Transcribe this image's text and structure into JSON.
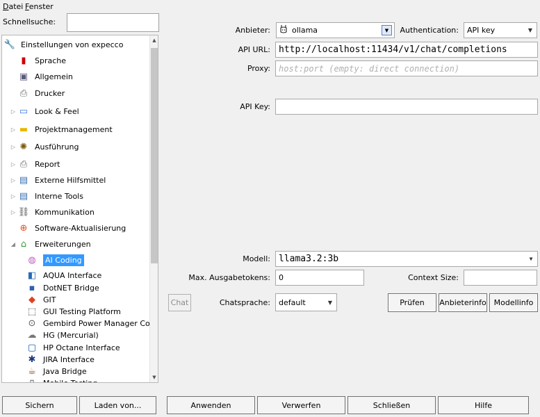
{
  "menu": {
    "datei_first": "D",
    "datei_rest": "atei",
    "fenster_first": "F",
    "fenster_rest": "enster"
  },
  "quicksearch": {
    "label": "Schnellsuche:",
    "value": ""
  },
  "tree": {
    "items": [
      {
        "label": "Einstellungen von expecco",
        "icon": "tools-icon",
        "level": 0,
        "expander": "none"
      },
      {
        "label": "Sprache",
        "icon": "flag-icon",
        "level": 1,
        "expander": "none"
      },
      {
        "label": "Allgemein",
        "icon": "general-icon",
        "level": 1,
        "expander": "none"
      },
      {
        "label": "Drucker",
        "icon": "printer-icon",
        "level": 1,
        "expander": "none"
      },
      {
        "label": "Look & Feel",
        "icon": "monitor-icon",
        "level": 1,
        "expander": "collapsed"
      },
      {
        "label": "Projektmanagement",
        "icon": "folder-icon",
        "level": 1,
        "expander": "collapsed"
      },
      {
        "label": "Ausführung",
        "icon": "gear-icon",
        "level": 1,
        "expander": "collapsed"
      },
      {
        "label": "Report",
        "icon": "printer-icon",
        "level": 1,
        "expander": "collapsed"
      },
      {
        "label": "Externe Hilfsmittel",
        "icon": "window-icon",
        "level": 1,
        "expander": "collapsed"
      },
      {
        "label": "Interne Tools",
        "icon": "window-icon",
        "level": 1,
        "expander": "collapsed"
      },
      {
        "label": "Kommunikation",
        "icon": "network-icon",
        "level": 1,
        "expander": "collapsed"
      },
      {
        "label": "Software-Aktualisierung",
        "icon": "update-icon",
        "level": 1,
        "expander": "none"
      },
      {
        "label": "Erweiterungen",
        "icon": "plugin-icon",
        "level": 1,
        "expander": "expanded"
      },
      {
        "label": "AI Coding",
        "icon": "brain-icon",
        "level": 2,
        "expander": "none",
        "selected": true
      },
      {
        "label": "AQUA Interface",
        "icon": "aqua-icon",
        "level": 2,
        "expander": "none"
      },
      {
        "label": "DotNET Bridge",
        "icon": "dotnet-icon",
        "level": 2,
        "expander": "none"
      },
      {
        "label": "GIT",
        "icon": "git-icon",
        "level": 2,
        "expander": "none"
      },
      {
        "label": "GUI Testing Platform",
        "icon": "gui-testing-icon",
        "level": 2,
        "expander": "none"
      },
      {
        "label": "Gembird Power Manager Con",
        "icon": "power-manager-icon",
        "level": 2,
        "expander": "none"
      },
      {
        "label": "HG (Mercurial)",
        "icon": "mercurial-icon",
        "level": 2,
        "expander": "none"
      },
      {
        "label": "HP Octane Interface",
        "icon": "octane-icon",
        "level": 2,
        "expander": "none"
      },
      {
        "label": "JIRA Interface",
        "icon": "jira-icon",
        "level": 2,
        "expander": "none"
      },
      {
        "label": "Java Bridge",
        "icon": "java-icon",
        "level": 2,
        "expander": "none"
      },
      {
        "label": "Mobile Testing",
        "icon": "mobile-icon",
        "level": 2,
        "expander": "none"
      }
    ]
  },
  "form": {
    "provider_label": "Anbieter:",
    "provider_value": "ollama",
    "auth_label": "Authentication:",
    "auth_value": "API key",
    "apiurl_label": "API URL:",
    "apiurl_value": "http://localhost:11434/v1/chat/completions",
    "proxy_label": "Proxy:",
    "proxy_placeholder": "host:port  (empty: direct connection)",
    "apikey_label": "API Key:",
    "apikey_value": "",
    "model_label": "Modell:",
    "model_value": "llama3.2:3b",
    "maxtokens_label": "Max. Ausgabetokens:",
    "maxtokens_value": "0",
    "context_label": "Context Size:",
    "context_value": "",
    "chat_button": "Chat",
    "chatlang_label": "Chatsprache:",
    "chatlang_value": "default",
    "check_button": "Prüfen",
    "providerinfo_button": "Anbieterinfo",
    "modelinfo_button": "Modellinfo"
  },
  "bottom": {
    "save": "Sichern",
    "load": "Laden von...",
    "apply": "Anwenden",
    "discard": "Verwerfen",
    "close": "Schließen",
    "help": "Hilfe"
  }
}
